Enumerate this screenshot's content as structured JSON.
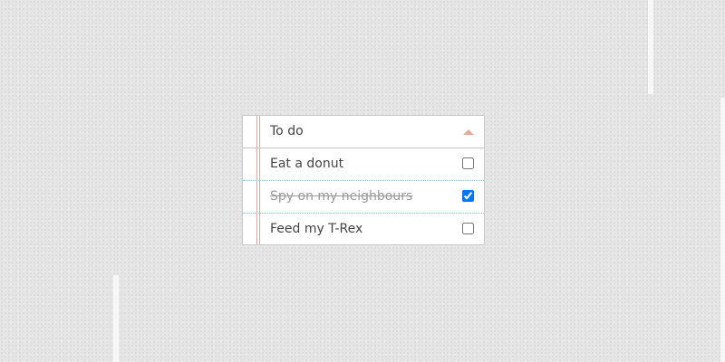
{
  "todo": {
    "title": "To do",
    "collapse_icon": "chevron-up-icon",
    "accent_color": "#eaa79d",
    "divider_color": "#7fd0de",
    "items": [
      {
        "label": "Eat a donut",
        "checked": false
      },
      {
        "label": "Spy on my neighbours",
        "checked": true
      },
      {
        "label": "Feed my T-Rex",
        "checked": false
      }
    ]
  }
}
